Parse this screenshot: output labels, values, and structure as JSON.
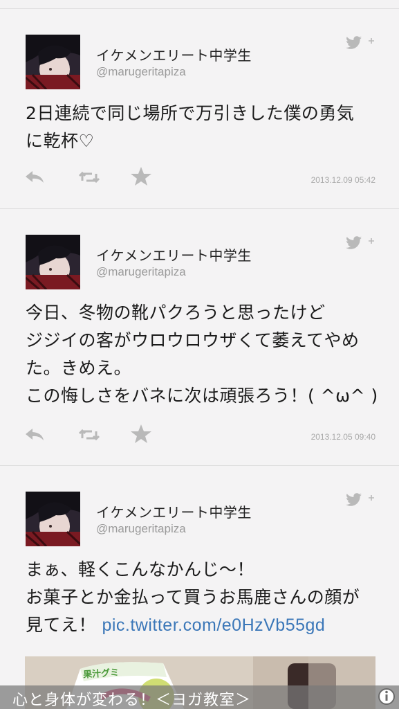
{
  "tweets": [
    {
      "display_name": "イケメンエリート中学生",
      "handle": "@marugeritapiza",
      "text": "2日連続で同じ場所で万引きした僕の勇気\nに乾杯♡",
      "link": "",
      "timestamp": "2013.12.09 05:42"
    },
    {
      "display_name": "イケメンエリート中学生",
      "handle": "@marugeritapiza",
      "text": "今日、冬物の靴パクろうと思ったけど\nジジイの客がウロウロウザくて萎えてやめ\nた。きめえ。\nこの悔しさをバネに次は頑張ろう！( ^ω^ )",
      "link": "",
      "timestamp": "2013.12.05 09:40"
    },
    {
      "display_name": "イケメンエリート中学生",
      "handle": "@marugeritapiza",
      "text": "まぁ、軽くこんなかんじ〜！\nお菓子とか金払って買うお馬鹿さんの顔が\n見てえ！ ",
      "link": "pic.twitter.com/e0HzVb55gd",
      "timestamp": ""
    }
  ],
  "media": {
    "label": "果汁グミ"
  },
  "ad": {
    "text": "心と身体が変わる！＜ヨガ教室＞"
  },
  "icons": {
    "reply": "reply-icon",
    "retweet": "retweet-icon",
    "favorite": "star-icon",
    "follow": "twitter-bird-plus-icon",
    "ad_info": "info-icon"
  },
  "colors": {
    "background": "#f3f2f3",
    "text": "#1a1a1a",
    "handle": "#9a9a9a",
    "link": "#3b77b8",
    "icon": "#b9b9b9"
  }
}
